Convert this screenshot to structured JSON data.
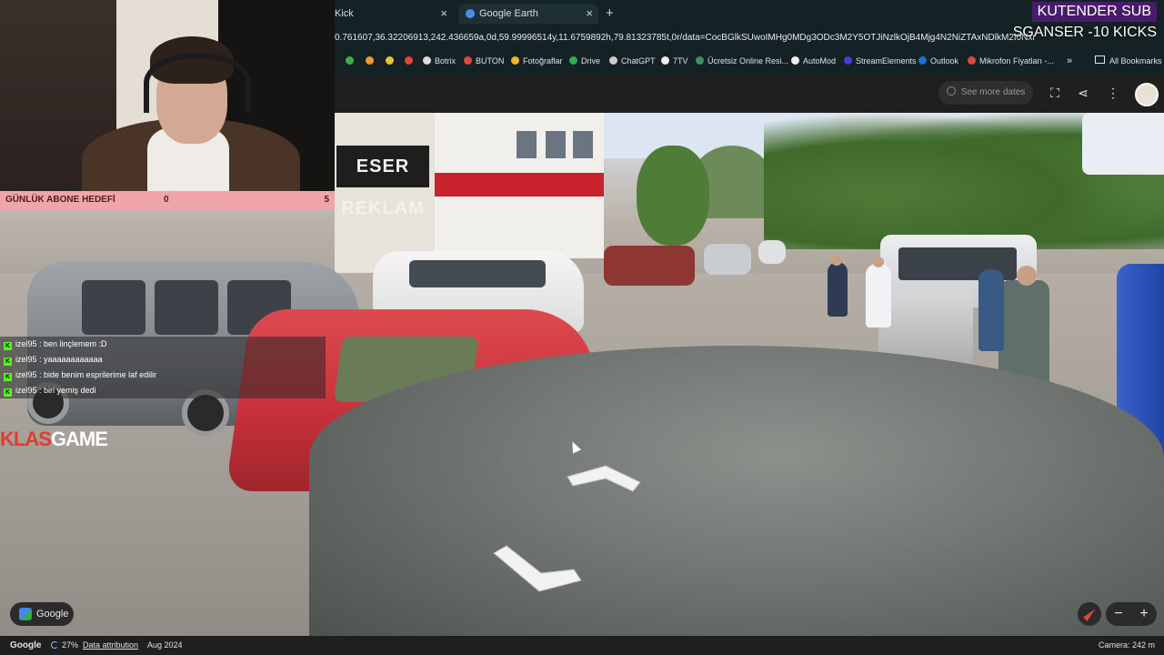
{
  "browser": {
    "tabs": [
      {
        "label": "Kick",
        "active": false
      },
      {
        "label": "Google Earth",
        "active": true
      }
    ],
    "new_tab_label": "+",
    "close_label": "×",
    "url": "0.761607,36.32206913,242.436659a,0d,59.99996514y,11.6759892h,79.81323785t,0r/data=CocBGlkSUwoIMHg0MDg3ODc3M2Y5OTJiNzlkOjB4Mjg4N2NiZTAxNDlkM2I0NxndLLnlfmJEQC...",
    "bookmarks": [
      {
        "label": "",
        "icon": "bookmark-green-icon",
        "color": "#3fae49"
      },
      {
        "label": "",
        "icon": "bookmark-orange-icon",
        "color": "#f29a2e"
      },
      {
        "label": "",
        "icon": "bookmark-yellow-icon",
        "color": "#e3c33a"
      },
      {
        "label": "",
        "icon": "bookmark-red-icon",
        "color": "#e0463c"
      },
      {
        "label": "Botrix",
        "icon": "botrix-icon",
        "color": "#dddddd"
      },
      {
        "label": "BUTON",
        "icon": "buton-icon",
        "color": "#e0463c"
      },
      {
        "label": "Fotoğraflar",
        "icon": "photos-icon",
        "color": "#f0b429"
      },
      {
        "label": "Drive",
        "icon": "drive-icon",
        "color": "#34a853"
      },
      {
        "label": "ChatGPT",
        "icon": "chatgpt-icon",
        "color": "#cccccc"
      },
      {
        "label": "7TV",
        "icon": "7tv-icon",
        "color": "#eeeeee"
      },
      {
        "label": "Ücretsiz Online Resi...",
        "icon": "rp-icon",
        "color": "#3a8f6b"
      },
      {
        "label": "AutoMod",
        "icon": "automod-icon",
        "color": "#eeeeee"
      },
      {
        "label": "StreamElements",
        "icon": "streamelements-icon",
        "color": "#4a3ad6"
      },
      {
        "label": "Outlook",
        "icon": "outlook-icon",
        "color": "#1f6fd0"
      },
      {
        "label": "Mikrofon Fiyatları -...",
        "icon": "mikrofon-icon",
        "color": "#d9463c"
      }
    ],
    "more_label": "»",
    "all_bookmarks_label": "All Bookmarks"
  },
  "earth": {
    "see_more_dates": "See more dates",
    "google_label": "Google",
    "zoom_minus": "−",
    "zoom_plus": "+"
  },
  "overlay": {
    "sub_title": "KUTENDER SUB",
    "sub_line": "SGANSER -10 KICKS",
    "goal_label": "GÜNLÜK ABONE HEDEFİ",
    "goal_current": "0",
    "goal_max": "5",
    "brand_a": "KLAS",
    "brand_b": "GAME",
    "storefront_sign": "ESER REKLAM"
  },
  "chat": [
    {
      "user": "izel95",
      "text": "ben linçlemem :D"
    },
    {
      "user": "izel95",
      "text": "yaaaaaaaaaaaa"
    },
    {
      "user": "izel95",
      "text": "bide benim esprilerime laf edilir"
    },
    {
      "user": "izel95",
      "text": "biri yemiş dedi"
    }
  ],
  "statusbar": {
    "google": "Google",
    "loading": "27%",
    "data_attribution": "Data attribution",
    "date": "Aug 2024",
    "camera": "Camera: 242 m"
  }
}
